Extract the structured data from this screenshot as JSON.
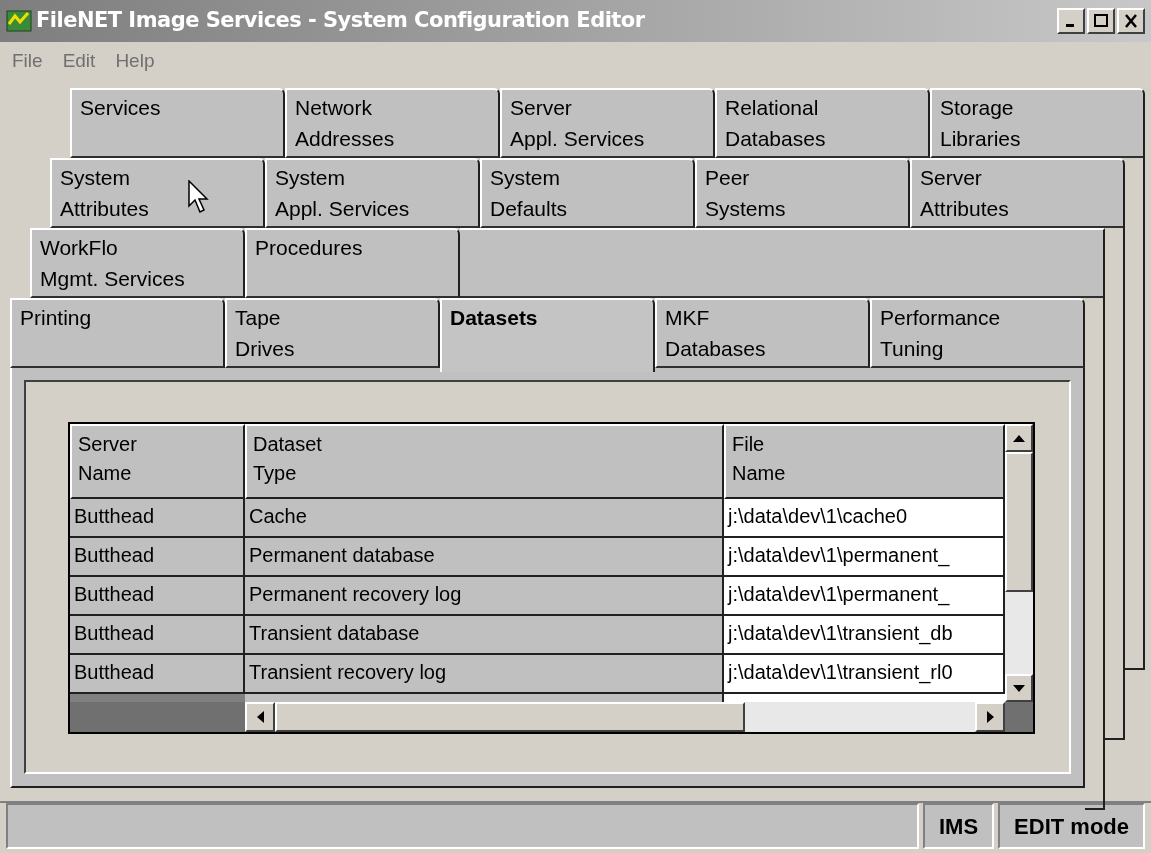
{
  "window": {
    "title": "FileNET Image Services - System Configuration Editor"
  },
  "menu": [
    "File",
    "Edit",
    "Help"
  ],
  "tab_rows": [
    [
      {
        "label": "Services",
        "selected": false
      },
      {
        "label": "Network\nAddresses",
        "selected": false
      },
      {
        "label": "Server\nAppl. Services",
        "selected": false
      },
      {
        "label": "Relational\nDatabases",
        "selected": false
      },
      {
        "label": "Storage\nLibraries",
        "selected": false
      }
    ],
    [
      {
        "label": "System\nAttributes",
        "selected": false
      },
      {
        "label": "System\nAppl. Services",
        "selected": false
      },
      {
        "label": "System\nDefaults",
        "selected": false
      },
      {
        "label": "Peer\nSystems",
        "selected": false
      },
      {
        "label": "Server\nAttributes",
        "selected": false
      }
    ],
    [
      {
        "label": "WorkFlo\nMgmt. Services",
        "selected": false
      },
      {
        "label": "Procedures",
        "selected": false
      }
    ],
    [
      {
        "label": "Printing",
        "selected": false
      },
      {
        "label": "Tape\nDrives",
        "selected": false
      },
      {
        "label": "Datasets",
        "selected": true
      },
      {
        "label": "MKF\nDatabases",
        "selected": false
      },
      {
        "label": "Performance\nTuning",
        "selected": false
      }
    ]
  ],
  "table": {
    "columns": [
      "Server\nName",
      "Dataset\nType",
      "File\nName"
    ],
    "rows": [
      [
        "Butthead",
        "Cache",
        "j:\\data\\dev\\1\\cache0"
      ],
      [
        "Butthead",
        "Permanent database",
        "j:\\data\\dev\\1\\permanent_"
      ],
      [
        "Butthead",
        "Permanent recovery log",
        "j:\\data\\dev\\1\\permanent_"
      ],
      [
        "Butthead",
        "Transient database",
        "j:\\data\\dev\\1\\transient_db"
      ],
      [
        "Butthead",
        "Transient recovery log",
        "j:\\data\\dev\\1\\transient_rl0"
      ]
    ]
  },
  "status_bar": [
    "IMS",
    "EDIT mode"
  ]
}
